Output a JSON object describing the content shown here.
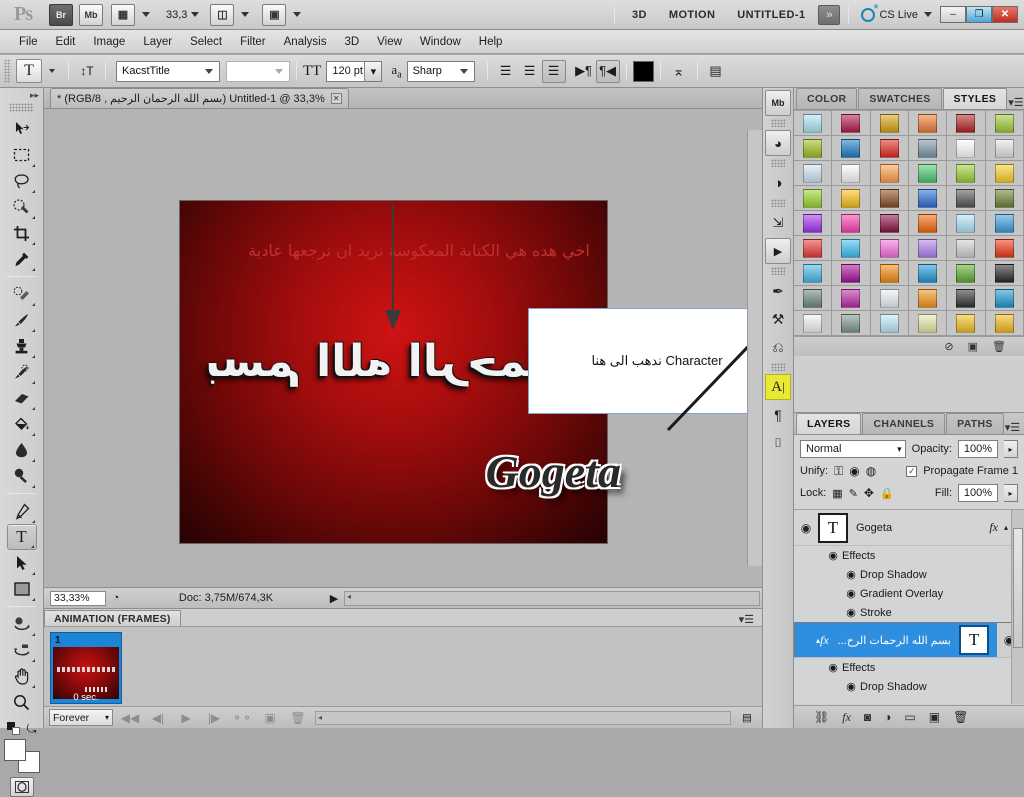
{
  "appbar": {
    "logo": "Ps",
    "bridge_label": "Br",
    "minibridge_label": "Mb",
    "zoom_value": "33,3",
    "workspaces": [
      "3D",
      "MOTION",
      "UNTITLED-1"
    ],
    "overflow_label": "»",
    "cs_live_label": "CS Live",
    "window_buttons": {
      "minimize": "–",
      "maximize": "❐",
      "close": "✕"
    }
  },
  "menubar": {
    "items": [
      "File",
      "Edit",
      "Image",
      "Layer",
      "Select",
      "Filter",
      "Analysis",
      "3D",
      "View",
      "Window",
      "Help"
    ]
  },
  "options": {
    "tool_glyph": "T",
    "orientation_label": "↕T",
    "font_family": "KacstTitle",
    "font_style": "",
    "size_label": "TT",
    "font_size": "120 pt",
    "aa_label": "aa",
    "antialias": "Sharp",
    "align": [
      "left",
      "center",
      "right"
    ],
    "align_active": "right",
    "direction": [
      "ltr",
      "rtl"
    ],
    "direction_active": "rtl",
    "color_label": "text-color",
    "warp_label": "warp-text",
    "panels_label": "toggle-panels"
  },
  "toolbar": {
    "tools": [
      {
        "name": "move-tool",
        "glyph": "➤",
        "submenu": false,
        "active": false
      },
      {
        "name": "marquee-tool",
        "glyph": "⬚",
        "submenu": true,
        "active": false
      },
      {
        "name": "lasso-tool",
        "glyph": "○",
        "submenu": true,
        "active": false
      },
      {
        "name": "quick-selection-tool",
        "glyph": "◕",
        "submenu": true,
        "active": false
      },
      {
        "name": "crop-tool",
        "glyph": "⌗",
        "submenu": true,
        "active": false
      },
      {
        "name": "eyedropper-tool",
        "glyph": "✒",
        "submenu": true,
        "active": false
      },
      {
        "name": "spot-healing-brush-tool",
        "glyph": "✐",
        "submenu": true,
        "active": false
      },
      {
        "name": "brush-tool",
        "glyph": "✎",
        "submenu": true,
        "active": false
      },
      {
        "name": "clone-stamp-tool",
        "glyph": "⚓",
        "submenu": true,
        "active": false
      },
      {
        "name": "history-brush-tool",
        "glyph": "✏",
        "submenu": true,
        "active": false
      },
      {
        "name": "eraser-tool",
        "glyph": "▰",
        "submenu": true,
        "active": false
      },
      {
        "name": "paint-bucket-tool",
        "glyph": "◢",
        "submenu": true,
        "active": false
      },
      {
        "name": "gradient-tool",
        "glyph": "◆",
        "submenu": true,
        "active": false
      },
      {
        "name": "blur-tool",
        "glyph": "●",
        "submenu": true,
        "active": false
      },
      {
        "name": "pen-tool",
        "glyph": "✑",
        "submenu": true,
        "active": false
      },
      {
        "name": "type-tool",
        "glyph": "T",
        "submenu": true,
        "active": true
      },
      {
        "name": "path-selection-tool",
        "glyph": "➤",
        "submenu": true,
        "active": false
      },
      {
        "name": "rectangle-tool",
        "glyph": "■",
        "submenu": true,
        "active": false
      },
      {
        "name": "3d-object-rotate-tool",
        "glyph": "↻",
        "submenu": true,
        "active": false
      },
      {
        "name": "3d-camera-rotate-tool",
        "glyph": "↺",
        "submenu": true,
        "active": false
      },
      {
        "name": "hand-tool",
        "glyph": "✋",
        "submenu": true,
        "active": false
      },
      {
        "name": "zoom-tool",
        "glyph": "⌕",
        "submenu": false,
        "active": false
      }
    ],
    "foreground_color": "#ffffff",
    "background_color": "#ffffff",
    "quick-mask-label": "quick-mask"
  },
  "document": {
    "tab_title": "Untitled-1 @ 33,3% (بسم الله الرحمان الرحيم , RGB/8) *",
    "close_glyph": "✕",
    "annotation_arabic": "اخي هده هي الكتابة المعكوسة نريد ان نرجعها عادية",
    "callout_text": "Character ندهب الى هنا",
    "canvas_mirrored_text": "بسم الله الرحمان",
    "canvas_signature": "Gogeta",
    "status_zoom": "33,33%",
    "status_doc": "Doc: 3,75M/674,3K"
  },
  "animation": {
    "tab_label": "ANIMATION (FRAMES)",
    "frames": [
      {
        "number": "1",
        "duration": "0 sec."
      }
    ],
    "loop_value": "Forever",
    "buttons": [
      "select-first-frame",
      "select-previous-frame",
      "play",
      "select-next-frame",
      "tween",
      "duplicate-frame",
      "delete-frame"
    ]
  },
  "icondock": {
    "items": [
      {
        "name": "mini-bridge-icon",
        "glyph": "Mb",
        "highlight": false
      },
      {
        "name": "histogram-icon",
        "glyph": "◑",
        "highlight": false
      },
      {
        "name": "adjustments-icon",
        "glyph": "◐",
        "highlight": false
      },
      {
        "name": "history-icon",
        "glyph": "↺",
        "highlight": false
      },
      {
        "name": "actions-icon",
        "glyph": "▶",
        "highlight": false
      },
      {
        "name": "brush-presets-icon",
        "glyph": "✒",
        "highlight": false
      },
      {
        "name": "tool-presets-icon",
        "glyph": "⚒",
        "highlight": false
      },
      {
        "name": "clone-source-icon",
        "glyph": "⎇",
        "highlight": false
      },
      {
        "name": "character-panel-icon",
        "glyph": "A",
        "highlight": true
      },
      {
        "name": "paragraph-panel-icon",
        "glyph": "¶",
        "highlight": false
      },
      {
        "name": "3d-panel-icon",
        "glyph": "⬚",
        "highlight": false
      }
    ]
  },
  "swatches_panel": {
    "tabs": [
      "COLOR",
      "SWATCHES",
      "STYLES"
    ],
    "active_tab": "STYLES",
    "menu_glyph": "≡",
    "styles": [
      "#ace6f5",
      "#b11c4f",
      "#d8a413",
      "#ef7b36",
      "#b32626",
      "#9fcc3a",
      "#9fc11f",
      "#1c7fc4",
      "#e22c22",
      "#7d97ab",
      "#ffffff",
      "#e6e6e6",
      "#cfe4f7",
      "#fbfbfb",
      "#ffa14a",
      "#4fcb72",
      "#9ed137",
      "#fbd02c",
      "#9cd62e",
      "#fcc016",
      "#8a4e1f",
      "#2a6fd8",
      "#575757",
      "#6f8434",
      "#a633f0",
      "#f843b0",
      "#8b1345",
      "#f4690b",
      "#b3e4fb",
      "#3d9fe0",
      "#ed3a3a",
      "#3fc0f0",
      "#f472e0",
      "#b083f0",
      "#d2d2d2",
      "#ef3a18",
      "#4bb9e8",
      "#a5129c",
      "#f58a11",
      "#1f9ad8",
      "#5fae31",
      "#2b2b2b",
      "#6e8a84",
      "#bd2aa8",
      "#eaf2f7",
      "#f49518",
      "#333333",
      "#1e9ad4",
      "#f3f3f3",
      "#7e9892",
      "#bfe8f8",
      "#e6e9a8",
      "#f0c224",
      "#f2bb1e"
    ],
    "footer_buttons": [
      "clear-style",
      "new-style",
      "delete-style"
    ]
  },
  "layers_panel": {
    "tabs": [
      "LAYERS",
      "CHANNELS",
      "PATHS"
    ],
    "active_tab": "LAYERS",
    "menu_glyph": "≡",
    "blend_mode": "Normal",
    "opacity_label": "Opacity:",
    "opacity_value": "100%",
    "unify_label": "Unify:",
    "propagate_label": "Propagate Frame 1",
    "propagate_checked": true,
    "lock_label": "Lock:",
    "fill_label": "Fill:",
    "fill_value": "100%",
    "layers": [
      {
        "name": "Gogeta",
        "thumb_glyph": "T",
        "selected": false,
        "fx": "fx",
        "effects_label": "Effects",
        "effects": [
          "Drop Shadow",
          "Gradient Overlay",
          "Stroke"
        ]
      },
      {
        "name": "بسم الله الرحمات الرح...",
        "thumb_glyph": "T",
        "selected": true,
        "fx": "fx",
        "effects_label": "Effects",
        "effects": [
          "Drop Shadow"
        ]
      }
    ],
    "footer_buttons": [
      "link-layers",
      "add-layer-style",
      "add-layer-mask",
      "new-adjustment-layer",
      "new-group",
      "new-layer",
      "delete-layer"
    ]
  }
}
